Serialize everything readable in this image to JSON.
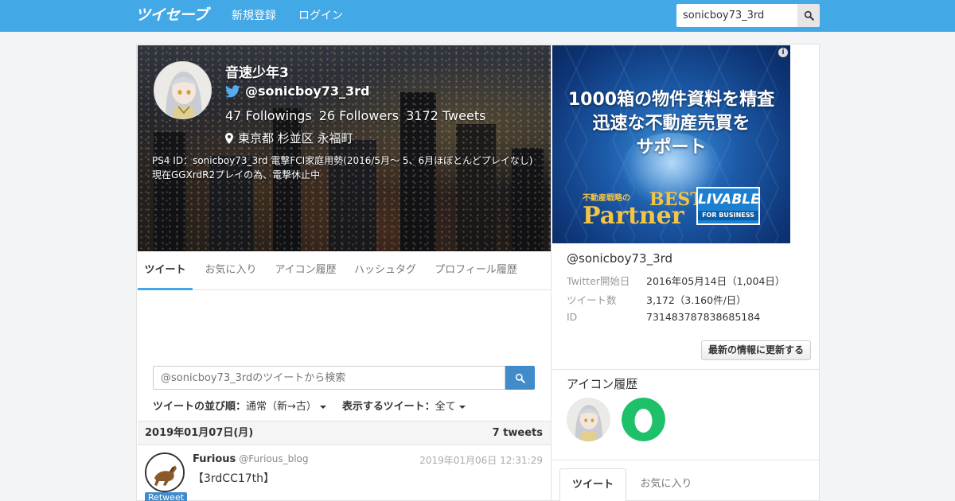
{
  "header": {
    "logo": "ツイセーブ",
    "nav": [
      "新規登録",
      "ログイン"
    ],
    "search_value": "sonicboy73_3rd"
  },
  "profile": {
    "name": "音速少年3",
    "handle": "@sonicboy73_3rd",
    "followings": "47 Followings",
    "followers": "26 Followers",
    "tweets": "3172 Tweets",
    "location": "東京都 杉並区 永福町",
    "bio": "PS4 ID：sonicboy73_3rd 電撃FCI家庭用勢(2016/5月～ 5、6月ほぼとんどプレイなし) 現在GGXrdR2プレイの為、電撃休止中"
  },
  "tabs": [
    "ツイート",
    "お気に入り",
    "アイコン履歴",
    "ハッシュタグ",
    "プロフィール履歴"
  ],
  "tweet_search": {
    "placeholder": "@sonicboy73_3rdのツイートから検索"
  },
  "sort": {
    "order_label": "ツイートの並び順：",
    "order_value": "通常（新→古）",
    "show_label": "表示するツイート：",
    "show_value": "全て"
  },
  "date_group": {
    "date": "2019年01月07日(月)",
    "count": "7 tweets"
  },
  "tweet": {
    "author": "Furious",
    "handle": "@Furious_blog",
    "time": "2019年01月06日 12:31:29",
    "text": "【3rdCC17th】",
    "badge": "Retweet"
  },
  "ad": {
    "line1": "1000箱の物件資料を精査",
    "line2": "迅速な不動産売買を",
    "line3": "サポート",
    "tagline": "不動産戦略の",
    "best": "BEST",
    "partner": "Partner",
    "logo": "LIVABLE",
    "logo_sub": "FOR BUSINESS",
    "info": "i"
  },
  "info": {
    "handle": "@sonicboy73_3rd",
    "rows": [
      {
        "k": "Twitter開始日",
        "v": "2016年05月14日（1,004日）"
      },
      {
        "k": "ツイート数",
        "v": "3,172（3.160件/日）"
      },
      {
        "k": "ID",
        "v": "731483787838685184"
      }
    ],
    "update_button": "最新の情報に更新する"
  },
  "icon_history": {
    "title": "アイコン履歴"
  },
  "right_tabs": [
    "ツイート",
    "お気に入り"
  ],
  "colors": {
    "brand": "#42a8e6",
    "primary_button": "#428bca",
    "egg_icon": "#1ec16a"
  }
}
